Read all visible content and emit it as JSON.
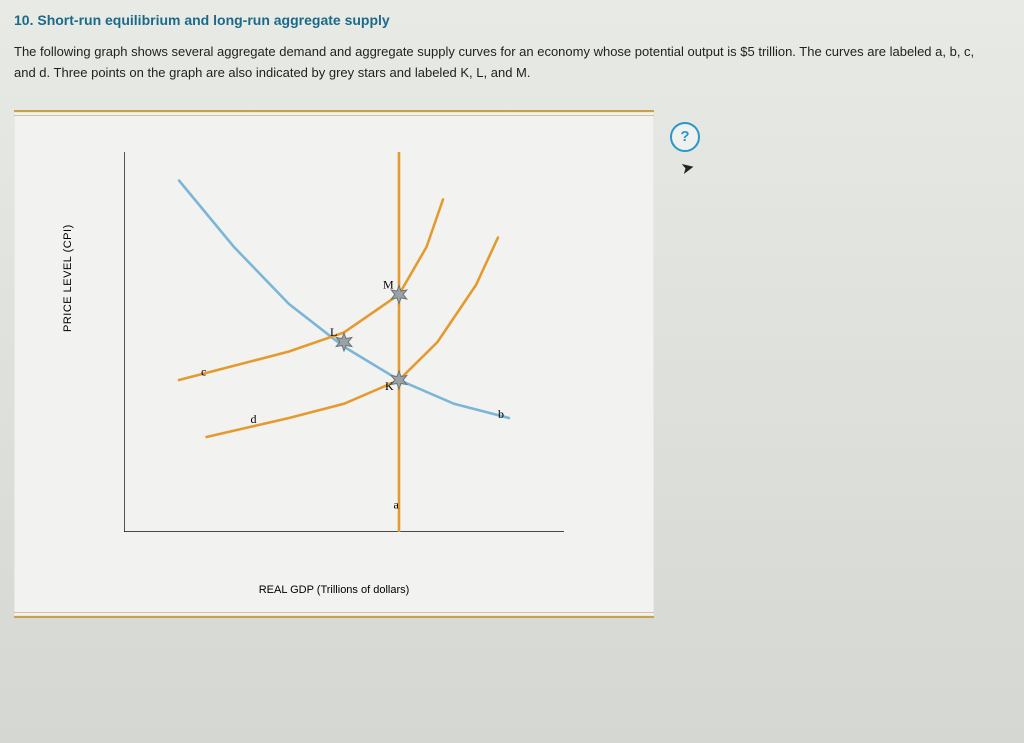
{
  "heading": "10. Short-run equilibrium and long-run aggregate supply",
  "intro": "The following graph shows several aggregate demand and aggregate supply curves for an economy whose potential output is $5 trillion. The curves are labeled a, b, c, and d. Three points on the graph are also indicated by grey stars and labeled K, L, and M.",
  "help": "?",
  "chart_data": {
    "type": "line",
    "title": "",
    "xlabel": "REAL GDP (Trillions of dollars)",
    "ylabel": "PRICE LEVEL (CPI)",
    "xlim": [
      0,
      8
    ],
    "ylim": [
      20,
      100
    ],
    "xticks": [
      0,
      1,
      2,
      3,
      4,
      5,
      6,
      7,
      8
    ],
    "yticks": [
      20,
      30,
      40,
      50,
      60,
      70,
      80,
      90,
      100
    ],
    "series": [
      {
        "name": "a",
        "kind": "LRAS vertical",
        "color": "#e59a2e",
        "points": [
          [
            5,
            20
          ],
          [
            5,
            100
          ]
        ]
      },
      {
        "name": "b",
        "kind": "AD (blue)",
        "color": "#7bb6d6",
        "points": [
          [
            1,
            94
          ],
          [
            2,
            80
          ],
          [
            3,
            68
          ],
          [
            4,
            59
          ],
          [
            5,
            52
          ],
          [
            6,
            47
          ],
          [
            7,
            44
          ]
        ]
      },
      {
        "name": "c",
        "kind": "SRAS upper (orange)",
        "color": "#e59a2e",
        "points": [
          [
            1,
            52
          ],
          [
            2,
            55
          ],
          [
            3,
            58
          ],
          [
            4,
            62
          ],
          [
            5,
            70
          ],
          [
            5.5,
            80
          ],
          [
            5.8,
            90
          ]
        ]
      },
      {
        "name": "d",
        "kind": "SRAS lower (orange)",
        "color": "#e59a2e",
        "points": [
          [
            1.5,
            40
          ],
          [
            3,
            44
          ],
          [
            4,
            47
          ],
          [
            5,
            52
          ],
          [
            5.7,
            60
          ],
          [
            6.4,
            72
          ],
          [
            6.8,
            82
          ]
        ]
      }
    ],
    "curve_labels": {
      "a": [
        4.9,
        25
      ],
      "b": [
        6.8,
        44
      ],
      "c": [
        1.4,
        53
      ],
      "d": [
        2.3,
        43
      ]
    },
    "points": [
      {
        "name": "K",
        "x": 5,
        "y": 52
      },
      {
        "name": "L",
        "x": 4,
        "y": 60
      },
      {
        "name": "M",
        "x": 5,
        "y": 70
      }
    ],
    "point_label_offsets": {
      "K": [
        -14,
        10
      ],
      "L": [
        -14,
        -6
      ],
      "M": [
        -16,
        -6
      ]
    }
  }
}
